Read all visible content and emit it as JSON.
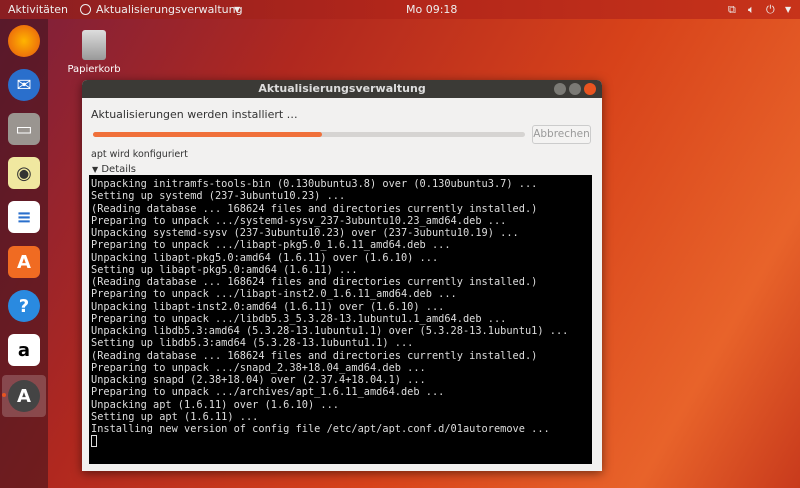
{
  "topbar": {
    "activities": "Aktivitäten",
    "app_menu": "Aktualisierungsverwaltung",
    "clock": "Mo 09:18"
  },
  "dock": {
    "items": [
      "firefox",
      "thunderbird",
      "files",
      "rhythmbox",
      "libreoffice-writer",
      "ubuntu-software",
      "help",
      "amazon",
      "software-updater"
    ]
  },
  "desktop": {
    "trash_label": "Papierkorb"
  },
  "window": {
    "title": "Aktualisierungsverwaltung",
    "heading": "Aktualisierungen werden installiert …",
    "progress_percent": 53,
    "cancel_label": "Abbrechen",
    "status": "apt wird konfiguriert",
    "details_label": "Details",
    "terminal_lines": [
      "Unpacking initramfs-tools-bin (0.130ubuntu3.8) over (0.130ubuntu3.7) ...",
      "Setting up systemd (237-3ubuntu10.23) ...",
      "(Reading database ... 168624 files and directories currently installed.)",
      "Preparing to unpack .../systemd-sysv_237-3ubuntu10.23_amd64.deb ...",
      "Unpacking systemd-sysv (237-3ubuntu10.23) over (237-3ubuntu10.19) ...",
      "Preparing to unpack .../libapt-pkg5.0_1.6.11_amd64.deb ...",
      "Unpacking libapt-pkg5.0:amd64 (1.6.11) over (1.6.10) ...",
      "Setting up libapt-pkg5.0:amd64 (1.6.11) ...",
      "(Reading database ... 168624 files and directories currently installed.)",
      "Preparing to unpack .../libapt-inst2.0_1.6.11_amd64.deb ...",
      "Unpacking libapt-inst2.0:amd64 (1.6.11) over (1.6.10) ...",
      "Preparing to unpack .../libdb5.3_5.3.28-13.1ubuntu1.1_amd64.deb ...",
      "Unpacking libdb5.3:amd64 (5.3.28-13.1ubuntu1.1) over (5.3.28-13.1ubuntu1) ...",
      "Setting up libdb5.3:amd64 (5.3.28-13.1ubuntu1.1) ...",
      "(Reading database ... 168624 files and directories currently installed.)",
      "Preparing to unpack .../snapd_2.38+18.04_amd64.deb ...",
      "Unpacking snapd (2.38+18.04) over (2.37.4+18.04.1) ...",
      "Preparing to unpack .../archives/apt_1.6.11_amd64.deb ...",
      "Unpacking apt (1.6.11) over (1.6.10) ...",
      "Setting up apt (1.6.11) ...",
      "Installing new version of config file /etc/apt/apt.conf.d/01autoremove ..."
    ]
  },
  "colors": {
    "accent": "#e95420",
    "titlebar": "#3b3a36"
  }
}
